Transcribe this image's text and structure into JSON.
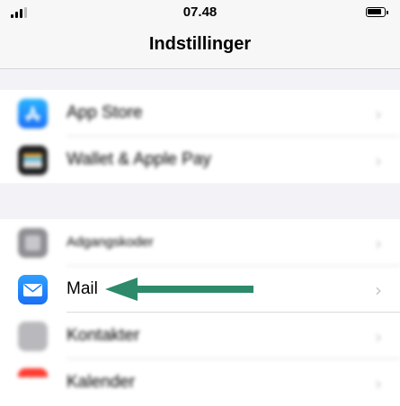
{
  "status_bar": {
    "time": "07.48"
  },
  "header": {
    "title": "Indstillinger"
  },
  "settings_rows": [
    {
      "label": "App Store",
      "icon": "app-store-icon",
      "color": "#1a8cf9"
    },
    {
      "label": "Wallet & Apple Pay",
      "icon": "wallet-icon",
      "color": "#1f1f1f"
    },
    {
      "label": "Adgangskoder",
      "icon": "passwords-icon",
      "color": "#8e8e93"
    },
    {
      "label": "Mail",
      "icon": "mail-icon",
      "color": "#1a84ff"
    },
    {
      "label": "Kontakter",
      "icon": "contacts-icon",
      "color": "#8e8e93"
    },
    {
      "label": "Kalender",
      "icon": "calendar-icon",
      "color": "#ff3b30"
    }
  ],
  "annotation": {
    "arrow_color": "#2e8a6a"
  }
}
